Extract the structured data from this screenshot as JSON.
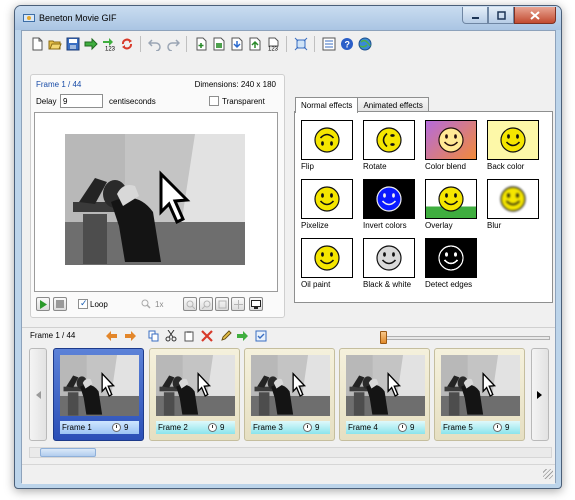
{
  "window": {
    "title": "Beneton Movie GIF"
  },
  "toolbar": {
    "icons": [
      "new-icon",
      "open-icon",
      "save-icon",
      "export-icon",
      "numbering-icon",
      "refresh-icon",
      "undo-icon",
      "redo-icon",
      "insert-frame-icon",
      "edit-frame-icon",
      "import-icon",
      "export-frames-icon",
      "renumber-icon",
      "resize-icon",
      "properties-icon",
      "help-icon",
      "web-icon"
    ]
  },
  "frame_panel": {
    "frame_label": "Frame 1 / 44",
    "dimensions": "Dimensions: 240 x 180",
    "delay_label": "Delay",
    "delay_value": "9",
    "delay_unit": "centiseconds",
    "transparent_label": "Transparent",
    "transparent_checked": false,
    "loop_label": "Loop",
    "loop_checked": true,
    "zoom_value": "1x"
  },
  "effects": {
    "tabs": [
      "Normal effects",
      "Animated effects"
    ],
    "active_tab": "Normal effects",
    "items": [
      "Flip",
      "Rotate",
      "Color blend",
      "Back color",
      "Pixelize",
      "Invert colors",
      "Overlay",
      "Blur",
      "Oil paint",
      "Black & white",
      "Detect edges"
    ]
  },
  "timeline": {
    "frame_label": "Frame 1 / 44",
    "slider_position": 0.0,
    "frames": [
      {
        "name": "Frame 1",
        "delay": "9",
        "selected": true
      },
      {
        "name": "Frame 2",
        "delay": "9",
        "selected": false
      },
      {
        "name": "Frame 3",
        "delay": "9",
        "selected": false
      },
      {
        "name": "Frame 4",
        "delay": "9",
        "selected": false
      },
      {
        "name": "Frame 5",
        "delay": "9",
        "selected": false
      }
    ]
  },
  "colors": {
    "accent": "#1a4da8",
    "selection": "#2b4fb7",
    "thumb_bar": "#8be4ec",
    "delete": "#d83a2a"
  }
}
